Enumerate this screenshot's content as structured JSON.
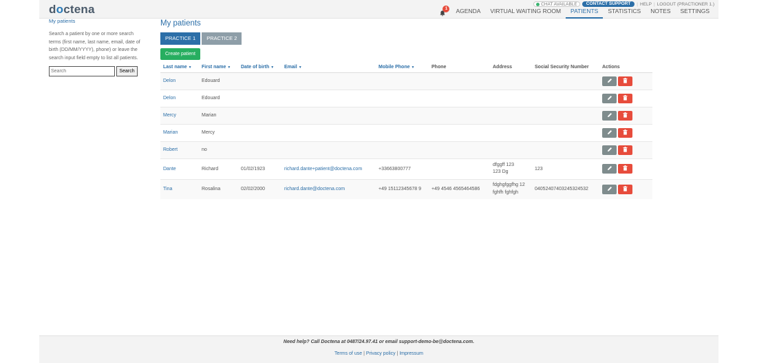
{
  "brand": {
    "logo_left": "d",
    "logo_pin": "o",
    "logo_right": "ctena"
  },
  "utility": {
    "chat": "CHAT AVAILABLE",
    "support": "CONTACT SUPPORT",
    "help": "HELP",
    "logout": "LOGOUT (PRACTIONER 1.)"
  },
  "notifications": {
    "count": "1"
  },
  "nav": [
    "AGENDA",
    "VIRTUAL WAITING ROOM",
    "PATIENTS",
    "STATISTICS",
    "NOTES",
    "SETTINGS"
  ],
  "sidebar": {
    "link": "My patients",
    "help": "Search a patient by one or more search terms (first name, last name, email, date of birth (DD/MM/YYYY), phone) or leave the search input field empty to list all patients.",
    "search_placeholder": "Search",
    "search_button": "Search"
  },
  "main": {
    "title": "My patients",
    "practices": [
      "PRACTICE 1",
      "PRACTICE 2"
    ],
    "create_button": "Create patient"
  },
  "table": {
    "headers": {
      "last_name": "Last name",
      "first_name": "First name",
      "dob": "Date of birth",
      "email": "Email",
      "mobile": "Mobile Phone",
      "phone": "Phone",
      "address": "Address",
      "ssn": "Social Security Number",
      "actions": "Actions"
    },
    "rows": [
      {
        "last": "Delon",
        "first": "Edouard",
        "dob": "",
        "email": "",
        "mobile": "",
        "phone": "",
        "address": "",
        "ssn": ""
      },
      {
        "last": "Delon",
        "first": "Edouard",
        "dob": "",
        "email": "",
        "mobile": "",
        "phone": "",
        "address": "",
        "ssn": ""
      },
      {
        "last": "Mercy",
        "first": "Marian",
        "dob": "",
        "email": "",
        "mobile": "",
        "phone": "",
        "address": "",
        "ssn": ""
      },
      {
        "last": "Marian",
        "first": "Mercy",
        "dob": "",
        "email": "",
        "mobile": "",
        "phone": "",
        "address": "",
        "ssn": ""
      },
      {
        "last": "Robert",
        "first": "no",
        "dob": "",
        "email": "",
        "mobile": "",
        "phone": "",
        "address": "",
        "ssn": ""
      },
      {
        "last": "Dante",
        "first": "Richard",
        "dob": "01/02/1923",
        "email": "richard.dante+patient@doctena.com",
        "mobile": "+33663800777",
        "phone": "",
        "address": "dfggff 123\n123 Dg",
        "ssn": "123"
      },
      {
        "last": "Tina",
        "first": "Rosalina",
        "dob": "02/02/2000",
        "email": "richard.dante@doctena.com",
        "mobile": "+49 15112345678 9",
        "phone": "+49 4546 4565464586",
        "address": "fdghgfggfhg 12\nfghfh fghfgh",
        "ssn": "04052407403245324532"
      }
    ]
  },
  "footer": {
    "help": "Need help? Call Doctena at 0487/24.97.41 or email support-demo-be@doctena.com.",
    "links": [
      "Terms of use",
      "Privacy policy",
      "Impressum"
    ]
  },
  "colors": {
    "accent": "#2c6fa8",
    "create": "#27ae60",
    "delete": "#e74c3c",
    "edit": "#7f8c8d"
  }
}
